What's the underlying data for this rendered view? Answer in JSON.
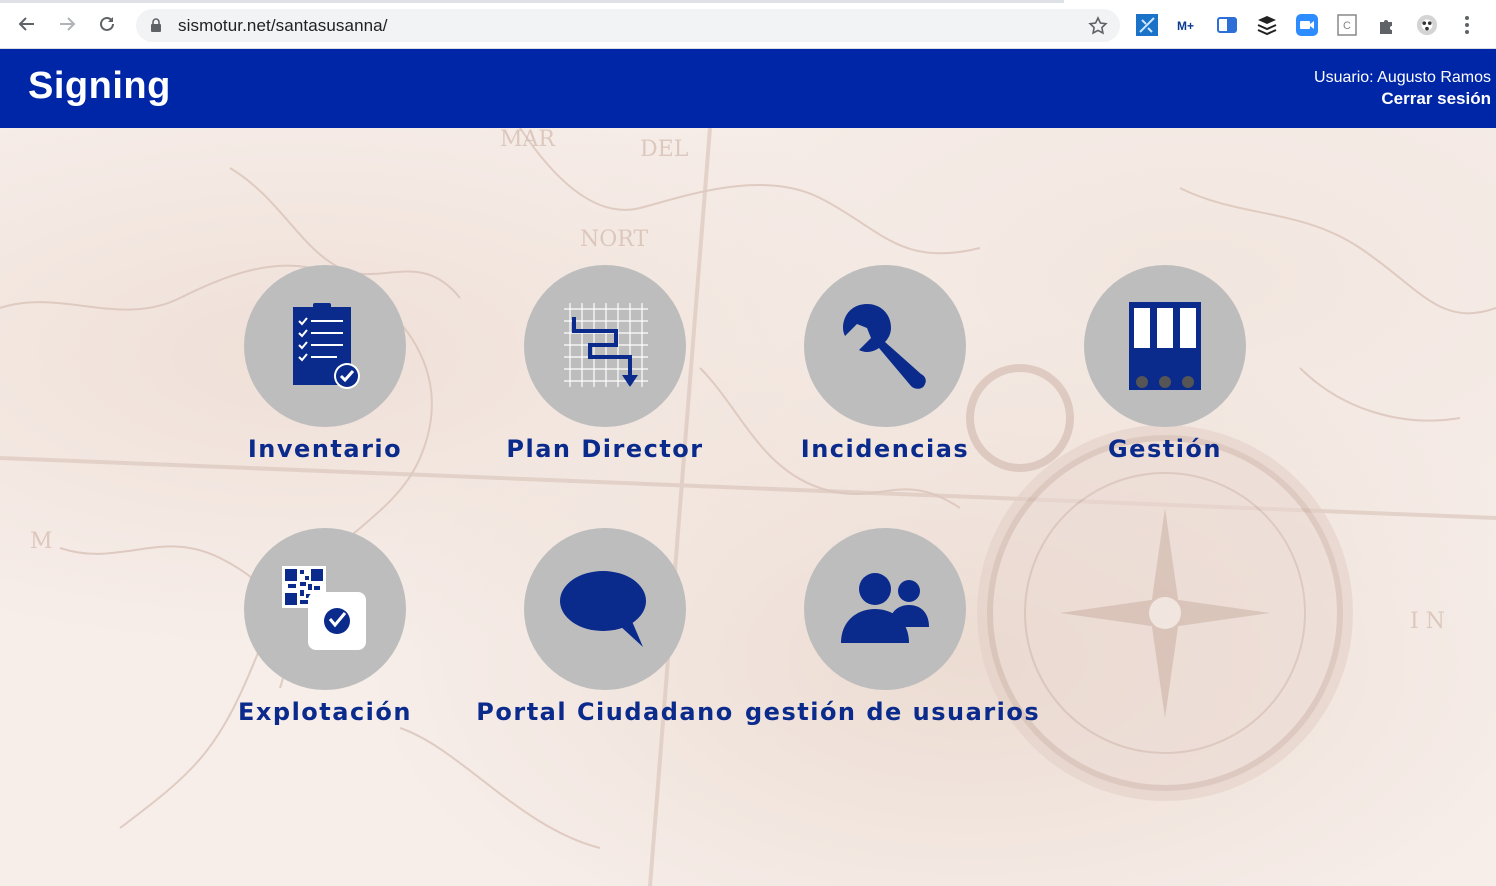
{
  "browser": {
    "url": "sismotur.net/santasusanna/",
    "extensions": [
      "puzzle-map-extension-icon",
      "movistar-plus-icon",
      "translate-extension-icon",
      "buffer-stack-icon",
      "zoom-video-icon",
      "c-bracket-extension-icon",
      "extensions-puzzle-icon",
      "profile-avatar-icon"
    ]
  },
  "header": {
    "brand": "Signing",
    "user_label": "Usuario: Augusto Ramos",
    "logout_label": "Cerrar sesión"
  },
  "modules": [
    {
      "label": "Inventario",
      "icon": "clipboard-checklist-icon"
    },
    {
      "label": "Plan Director",
      "icon": "grid-route-plan-icon"
    },
    {
      "label": "Incidencias",
      "icon": "wrench-icon"
    },
    {
      "label": "Gestión",
      "icon": "binders-icon"
    },
    {
      "label": "Explotación",
      "icon": "qr-code-scan-icon"
    },
    {
      "label": "Portal Ciudadano",
      "icon": "speech-bubble-icon"
    },
    {
      "label": "gestión de usuarios",
      "icon": "users-group-icon"
    }
  ],
  "colors": {
    "header_bg": "#0026a8",
    "icon_blue": "#0a2a8c",
    "circle_gray": "#bdbdbd"
  }
}
